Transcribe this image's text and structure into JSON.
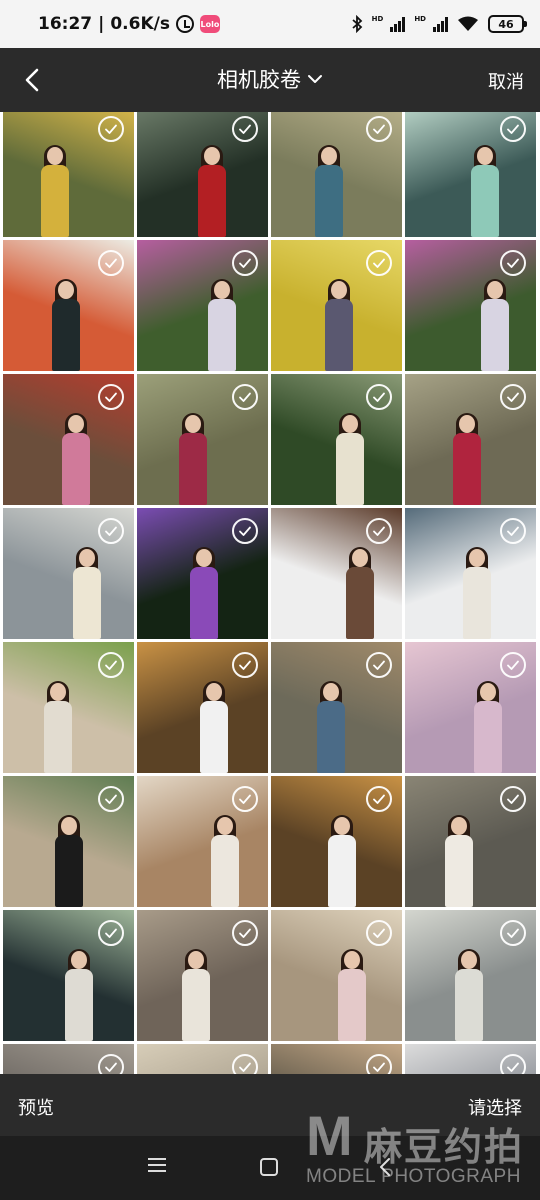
{
  "status_bar": {
    "time": "16:27",
    "speed": "0.6K/s",
    "app_badge": "Lolo",
    "hd1": "HD",
    "hd2": "HD",
    "battery": "46"
  },
  "header": {
    "title": "相机胶卷",
    "cancel_label": "取消"
  },
  "photos": [
    {
      "bg": "#5f6b3a",
      "accent": "#d9b84a",
      "outfit": "#d4b13c"
    },
    {
      "bg": "#233026",
      "accent": "#6d7d6a",
      "outfit": "#b31f23"
    },
    {
      "bg": "#7b7c5c",
      "accent": "#b7b08a",
      "outfit": "#3e6e82"
    },
    {
      "bg": "#3c5a57",
      "accent": "#b9d4c8",
      "outfit": "#8ec9b8"
    },
    {
      "bg": "#d55b36",
      "accent": "#ecece4",
      "outfit": "#1f2a2c"
    },
    {
      "bg": "#3f5e2d",
      "accent": "#b65ea0",
      "outfit": "#d8d4e2"
    },
    {
      "bg": "#c8b12e",
      "accent": "#e7d867",
      "outfit": "#5a5870"
    },
    {
      "bg": "#3d5b2e",
      "accent": "#b65ea0",
      "outfit": "#d8d4e2"
    },
    {
      "bg": "#6b4e3b",
      "accent": "#b53d2e",
      "outfit": "#d07a9a"
    },
    {
      "bg": "#6d6e4f",
      "accent": "#9ca07a",
      "outfit": "#9d2a46"
    },
    {
      "bg": "#2f4a26",
      "accent": "#8a9a76",
      "outfit": "#e7e1cf"
    },
    {
      "bg": "#6e6a55",
      "accent": "#a6a286",
      "outfit": "#b0243e"
    },
    {
      "bg": "#8c9499",
      "accent": "#d6d7d2",
      "outfit": "#ede6d3"
    },
    {
      "bg": "#142414",
      "accent": "#7b4db3",
      "outfit": "#8a4ab8"
    },
    {
      "bg": "#eeeeee",
      "accent": "#5b3b2a",
      "outfit": "#6a4a38"
    },
    {
      "bg": "#ecedee",
      "accent": "#556b7a",
      "outfit": "#e9e5dc"
    },
    {
      "bg": "#cdbfa8",
      "accent": "#7aa04c",
      "outfit": "#e2dcd0"
    },
    {
      "bg": "#5b4225",
      "accent": "#c99245",
      "outfit": "#f1f1f1"
    },
    {
      "bg": "#6d6a5a",
      "accent": "#a08a6a",
      "outfit": "#4b6b87"
    },
    {
      "bg": "#b59ab4",
      "accent": "#e6c6d2",
      "outfit": "#d7b8cc"
    },
    {
      "bg": "#b8a990",
      "accent": "#5f7d52",
      "outfit": "#1b1b1b"
    },
    {
      "bg": "#a88564",
      "accent": "#e3d7c6",
      "outfit": "#ece7de"
    },
    {
      "bg": "#5b4225",
      "accent": "#c99245",
      "outfit": "#f1f1f1"
    },
    {
      "bg": "#5c5a52",
      "accent": "#8a8575",
      "outfit": "#eeeae2"
    },
    {
      "bg": "#233032",
      "accent": "#9fb69a",
      "outfit": "#dedbd3"
    },
    {
      "bg": "#6f6459",
      "accent": "#a89b89",
      "outfit": "#e9e4da"
    },
    {
      "bg": "#a7967e",
      "accent": "#dfd3bd",
      "outfit": "#e4c9c9"
    },
    {
      "bg": "#8a8f8e",
      "accent": "#d4d6cf",
      "outfit": "#dcdcd5"
    },
    {
      "bg": "#6a6560",
      "accent": "#a39c92",
      "outfit": "#a17a5e"
    },
    {
      "bg": "#a89e8c",
      "accent": "#d7cdb8",
      "outfit": "#8a6d52"
    },
    {
      "bg": "#5e5748",
      "accent": "#c4a887",
      "outfit": "#3e3833"
    },
    {
      "bg": "#8b8f96",
      "accent": "#dcdcdc",
      "outfit": "#6c6d73"
    }
  ],
  "bottom_bar": {
    "preview_label": "预览",
    "select_label": "请选择"
  },
  "watermark": {
    "letter": "M",
    "chinese": "麻豆约拍",
    "english": "MODEL PHOTOGRAPH"
  }
}
